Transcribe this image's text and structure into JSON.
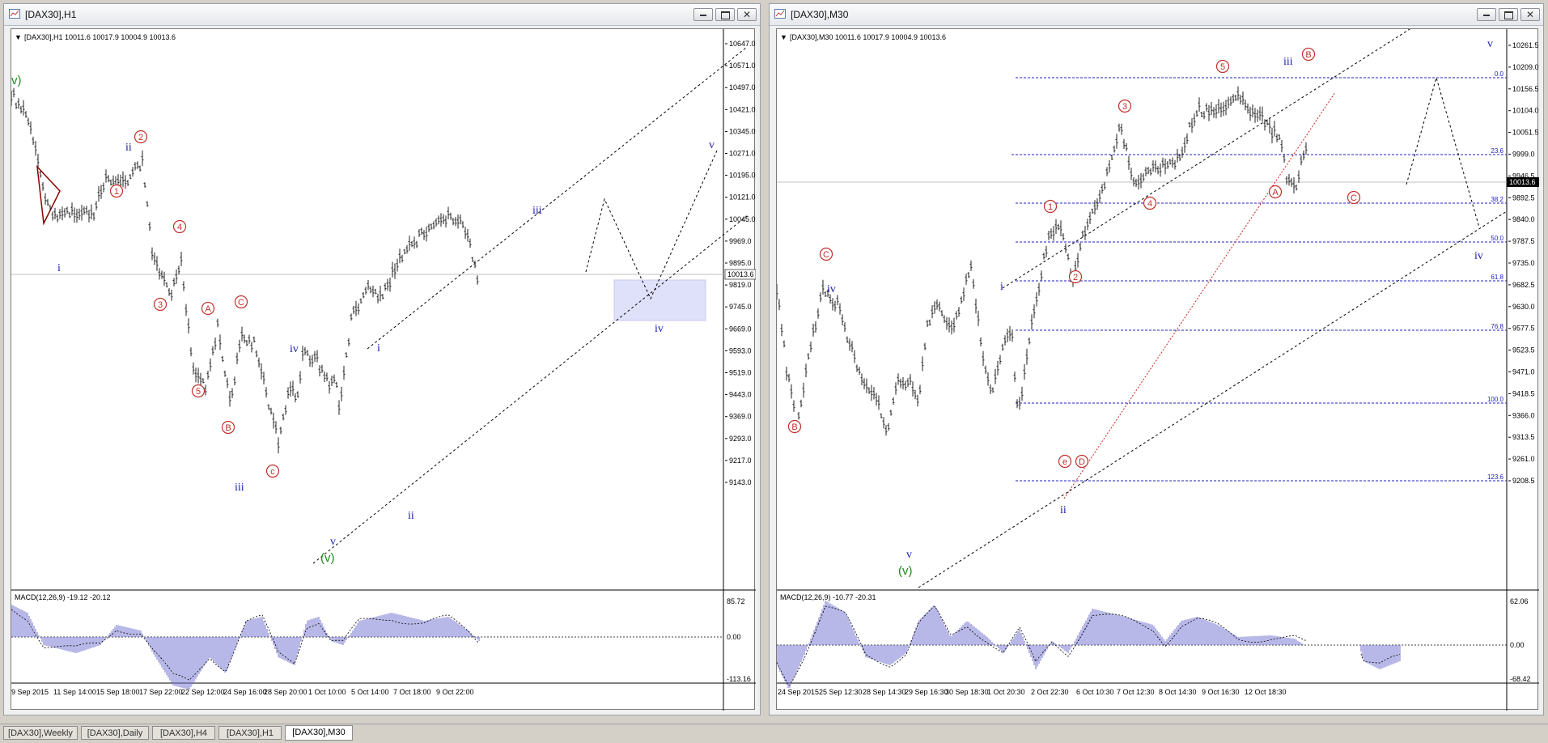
{
  "windows": [
    {
      "title": "[DAX30],H1",
      "info": "[DAX30],H1  10011.6 10017.9 10004.9 10013.6",
      "price_label": "10013.6",
      "macd_label": "MACD(12,26,9) -19.12 -20.12",
      "macd_ticks": [
        "85.72",
        "0.00",
        "-113.16"
      ],
      "price_ticks": [
        "10647.0",
        "10571.0",
        "10497.0",
        "10421.0",
        "10345.0",
        "10271.0",
        "10195.0",
        "10121.0",
        "10045.0",
        "9969.0",
        "9895.0",
        "9819.0",
        "9745.0",
        "9669.0",
        "9593.0",
        "9519.0",
        "9443.0",
        "9369.0",
        "9293.0",
        "9217.0",
        "9143.0"
      ],
      "time_ticks": [
        "9 Sep 2015",
        "11 Sep 14:00",
        "15 Sep 18:00",
        "17 Sep 22:00",
        "22 Sep 12:00",
        "24 Sep 16:00",
        "28 Sep 20:00",
        "1 Oct 10:00",
        "5 Oct 14:00",
        "7 Oct 18:00",
        "9 Oct 22:00"
      ],
      "wave_labels": {
        "blue": [
          "i",
          "ii",
          "iii",
          "iv",
          "v",
          "i",
          "ii",
          "iii",
          "iv",
          "v"
        ],
        "green": [
          "v)",
          "(v)"
        ],
        "red_circled": [
          "1",
          "2",
          "3",
          "4",
          "5",
          "A",
          "B",
          "C",
          "c"
        ]
      }
    },
    {
      "title": "[DAX30],M30",
      "info": "[DAX30],M30  10011.6 10017.9 10004.9 10013.6",
      "price_label": "10013.6",
      "macd_label": "MACD(12,26,9) -10.77 -20.31",
      "macd_ticks": [
        "62.06",
        "0.00",
        "-68.42"
      ],
      "price_ticks": [
        "10261.5",
        "10209.0",
        "10156.5",
        "10104.0",
        "10051.5",
        "9999.0",
        "9946.5",
        "9892.5",
        "9840.0",
        "9787.5",
        "9735.0",
        "9682.5",
        "9630.0",
        "9577.5",
        "9523.5",
        "9471.0",
        "9418.5",
        "9366.0",
        "9313.5",
        "9261.0",
        "9208.5"
      ],
      "time_ticks": [
        "24 Sep 2015",
        "25 Sep 12:30",
        "28 Sep 14:30",
        "29 Sep 16:30",
        "30 Sep 18:30",
        "1 Oct 20:30",
        "2 Oct 22:30",
        "6 Oct 10:30",
        "7 Oct 12:30",
        "8 Oct 14:30",
        "9 Oct 16:30",
        "12 Oct 18:30"
      ],
      "fib_levels": [
        "0.0",
        "23.6",
        "38.2",
        "50.0",
        "61.8",
        "76.8",
        "100.0",
        "123.6"
      ],
      "wave_labels": {
        "blue": [
          "iv",
          "i",
          "ii",
          "iii",
          "iv",
          "v",
          "v"
        ],
        "green": [
          "(v)"
        ],
        "red_circled": [
          "B",
          "C",
          "1",
          "2",
          "3",
          "4",
          "5",
          "A",
          "B",
          "C",
          "e",
          "D"
        ]
      }
    }
  ],
  "tabs": [
    "[DAX30],Weekly",
    "[DAX30],Daily",
    "[DAX30],H4",
    "[DAX30],H1",
    "[DAX30],M30"
  ],
  "active_tab": "[DAX30],M30",
  "colors": {
    "wave_blue": "#2020b0",
    "wave_red": "#c0302a",
    "wave_green": "#1f8a1f",
    "macd": "#7070d0",
    "fib": "#2222c0"
  }
}
